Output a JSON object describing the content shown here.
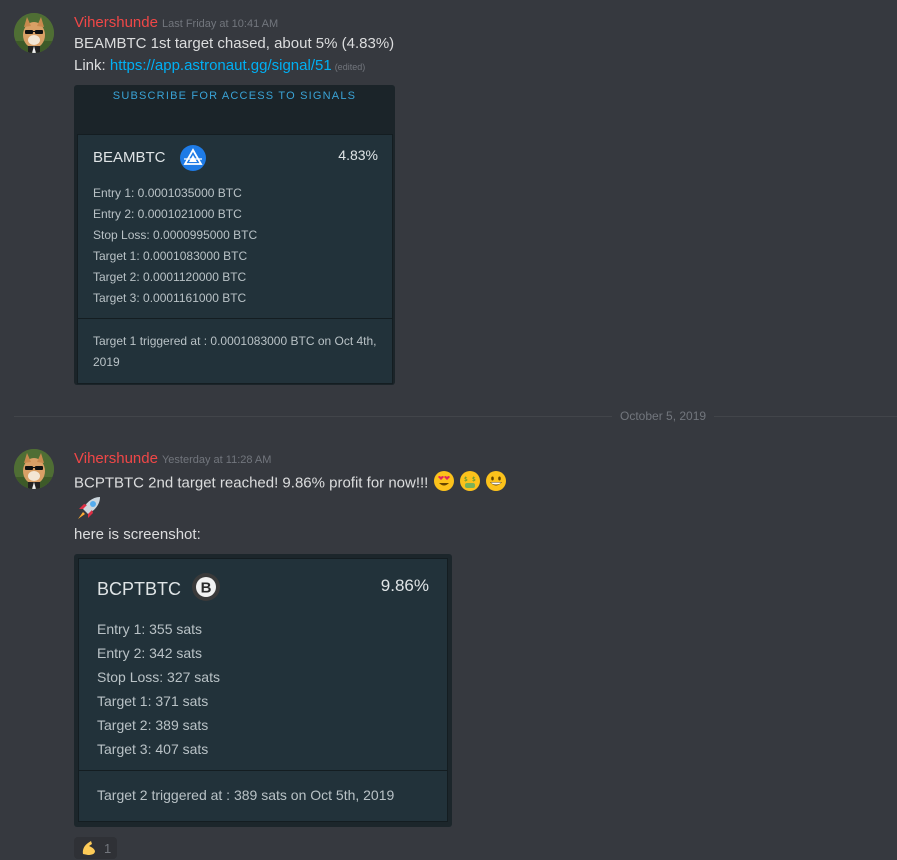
{
  "messages": [
    {
      "author": "Vihershunde",
      "timestamp": "Last Friday at 10:41 AM",
      "text1": "BEAMBTC 1st target chased, about 5% (4.83%)",
      "link_prefix": "Link: ",
      "link": "https://app.astronaut.gg/signal/51",
      "edited": "(edited)",
      "card": {
        "banner": "SUBSCRIBE FOR ACCESS TO SIGNALS",
        "ticker": "BEAMBTC",
        "coin_icon": "beam-coin-icon",
        "percent": "4.83%",
        "rows": [
          "Entry 1:  0.0001035000 BTC",
          "Entry 2:  0.0001021000 BTC",
          "Stop Loss:  0.0000995000 BTC",
          "Target 1:  0.0001083000 BTC",
          "Target 2:  0.0001120000 BTC",
          "Target 3:  0.0001161000 BTC"
        ],
        "trigger": "Target 1 triggered at : 0.0001083000 BTC on Oct 4th, 2019"
      }
    },
    {
      "author": "Vihershunde",
      "timestamp": "Yesterday at 11:28 AM",
      "text1": "BCPTBTC 2nd target reached! 9.86% profit for now!!!",
      "emojis": [
        "heart-eyes-emoji",
        "money-mouth-emoji",
        "grinning-emoji"
      ],
      "rocket": "rocket-emoji",
      "text2": "here is screenshot:",
      "card": {
        "ticker": "BCPTBTC",
        "coin_icon": "bcpt-coin-icon",
        "coin_letter": "B",
        "percent": "9.86%",
        "rows": [
          "Entry 1:  355 sats",
          "Entry 2:  342 sats",
          "Stop Loss:  327 sats",
          "Target 1:  371 sats",
          "Target 2:  389 sats",
          "Target 3:  407 sats"
        ],
        "trigger": "Target 2 triggered at : 389 sats on Oct 5th, 2019"
      },
      "reaction": {
        "emoji": "flexed-biceps-emoji",
        "count": "1"
      }
    }
  ],
  "date_divider": "October 5, 2019",
  "colors": {
    "background": "#36393f",
    "author": "#f04747",
    "link": "#00b0f4",
    "card": "#22323a",
    "banner_text": "#3aa3d6"
  }
}
